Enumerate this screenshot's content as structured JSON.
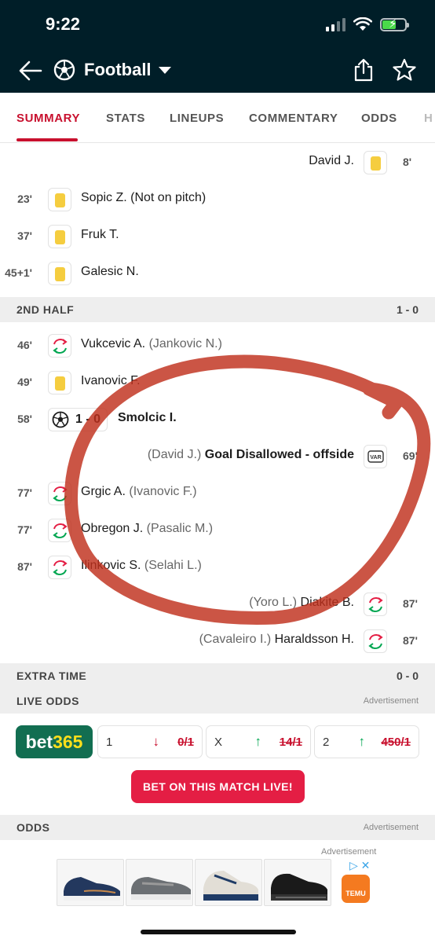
{
  "status_bar": {
    "time": "9:22"
  },
  "header": {
    "sport": "Football",
    "icons": [
      "back-arrow-icon",
      "football-icon",
      "dropdown-caret-icon",
      "share-icon",
      "star-icon"
    ]
  },
  "tabs": [
    "SUMMARY",
    "STATS",
    "LINEUPS",
    "COMMENTARY",
    "ODDS",
    "H"
  ],
  "first_half_incidents": [
    {
      "minute": "8'",
      "side": "away",
      "type": "yellow-card",
      "player": "David J."
    },
    {
      "minute": "23'",
      "side": "home",
      "type": "yellow-card",
      "player": "Sopic Z. (Not on pitch)"
    },
    {
      "minute": "37'",
      "side": "home",
      "type": "yellow-card",
      "player": "Fruk T."
    },
    {
      "minute": "45+1'",
      "side": "home",
      "type": "yellow-card",
      "player": "Galesic N."
    }
  ],
  "second_half": {
    "label": "2ND HALF",
    "score": "1 - 0"
  },
  "second_half_incidents": [
    {
      "minute": "46'",
      "side": "home",
      "type": "substitution",
      "player": "Vukcevic A.",
      "assist": "(Jankovic N.)"
    },
    {
      "minute": "49'",
      "side": "home",
      "type": "yellow-card",
      "player": "Ivanovic F."
    },
    {
      "minute": "58'",
      "side": "home",
      "type": "goal",
      "score": "1 - 0",
      "player": "Smolcic I."
    },
    {
      "minute": "69'",
      "side": "away",
      "type": "var",
      "player": "Goal Disallowed - offside",
      "assist": "(David J.)"
    },
    {
      "minute": "77'",
      "side": "home",
      "type": "substitution",
      "player": "Grgic A.",
      "assist": "(Ivanovic F.)"
    },
    {
      "minute": "77'",
      "side": "home",
      "type": "substitution",
      "player": "Obregon J.",
      "assist": "(Pasalic M.)"
    },
    {
      "minute": "87'",
      "side": "home",
      "type": "substitution",
      "player": "Ilinkovic S.",
      "assist": "(Selahi L.)"
    },
    {
      "minute": "87'",
      "side": "away",
      "type": "substitution",
      "player": "Diakite B.",
      "assist": "(Yoro L.)"
    },
    {
      "minute": "87'",
      "side": "away",
      "type": "substitution",
      "player": "Haraldsson H.",
      "assist": "(Cavaleiro I.)"
    }
  ],
  "extra_time": {
    "label": "EXTRA TIME",
    "score": "0 - 0"
  },
  "live_odds": {
    "label": "LIVE ODDS",
    "ad_label": "Advertisement",
    "bookmaker": {
      "name_part1": "bet",
      "name_part2": "365"
    },
    "odds": [
      {
        "key": "1",
        "value": "0/1",
        "trend": "down",
        "arrow": "↓"
      },
      {
        "key": "X",
        "value": "14/1",
        "trend": "up",
        "arrow": "↑"
      },
      {
        "key": "2",
        "value": "450/1",
        "trend": "up",
        "arrow": "↑"
      }
    ],
    "cta": "BET ON THIS MATCH LIVE!"
  },
  "odds_section": {
    "label": "ODDS",
    "ad_label": "Advertisement"
  },
  "ad_banner": {
    "caption": "Advertisement",
    "brand": "TEMU",
    "choices_icon": "▷ ✕"
  },
  "colors": {
    "header_bg": "#001e28",
    "accent": "#c8102e",
    "yellow_card": "#f5cd3f",
    "sub_green": "#00a651",
    "sub_red": "#e41e44",
    "bet365_green": "#126e51",
    "annotation_red": "#c0301c"
  }
}
